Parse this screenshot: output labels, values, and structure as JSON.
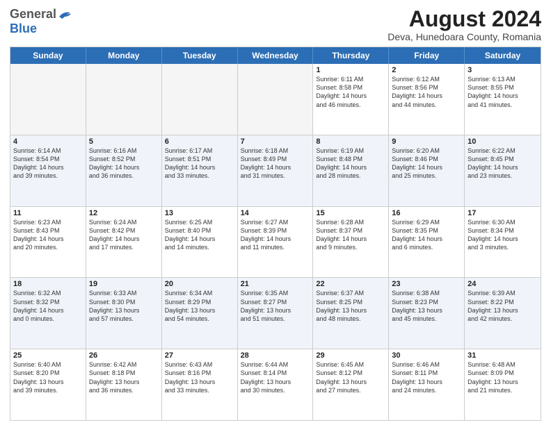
{
  "header": {
    "logo_general": "General",
    "logo_blue": "Blue",
    "month_title": "August 2024",
    "location": "Deva, Hunedoara County, Romania"
  },
  "days_of_week": [
    "Sunday",
    "Monday",
    "Tuesday",
    "Wednesday",
    "Thursday",
    "Friday",
    "Saturday"
  ],
  "weeks": [
    [
      {
        "day": "",
        "info": "",
        "empty": true
      },
      {
        "day": "",
        "info": "",
        "empty": true
      },
      {
        "day": "",
        "info": "",
        "empty": true
      },
      {
        "day": "",
        "info": "",
        "empty": true
      },
      {
        "day": "1",
        "info": "Sunrise: 6:11 AM\nSunset: 8:58 PM\nDaylight: 14 hours\nand 46 minutes.",
        "empty": false
      },
      {
        "day": "2",
        "info": "Sunrise: 6:12 AM\nSunset: 8:56 PM\nDaylight: 14 hours\nand 44 minutes.",
        "empty": false
      },
      {
        "day": "3",
        "info": "Sunrise: 6:13 AM\nSunset: 8:55 PM\nDaylight: 14 hours\nand 41 minutes.",
        "empty": false
      }
    ],
    [
      {
        "day": "4",
        "info": "Sunrise: 6:14 AM\nSunset: 8:54 PM\nDaylight: 14 hours\nand 39 minutes.",
        "empty": false
      },
      {
        "day": "5",
        "info": "Sunrise: 6:16 AM\nSunset: 8:52 PM\nDaylight: 14 hours\nand 36 minutes.",
        "empty": false
      },
      {
        "day": "6",
        "info": "Sunrise: 6:17 AM\nSunset: 8:51 PM\nDaylight: 14 hours\nand 33 minutes.",
        "empty": false
      },
      {
        "day": "7",
        "info": "Sunrise: 6:18 AM\nSunset: 8:49 PM\nDaylight: 14 hours\nand 31 minutes.",
        "empty": false
      },
      {
        "day": "8",
        "info": "Sunrise: 6:19 AM\nSunset: 8:48 PM\nDaylight: 14 hours\nand 28 minutes.",
        "empty": false
      },
      {
        "day": "9",
        "info": "Sunrise: 6:20 AM\nSunset: 8:46 PM\nDaylight: 14 hours\nand 25 minutes.",
        "empty": false
      },
      {
        "day": "10",
        "info": "Sunrise: 6:22 AM\nSunset: 8:45 PM\nDaylight: 14 hours\nand 23 minutes.",
        "empty": false
      }
    ],
    [
      {
        "day": "11",
        "info": "Sunrise: 6:23 AM\nSunset: 8:43 PM\nDaylight: 14 hours\nand 20 minutes.",
        "empty": false
      },
      {
        "day": "12",
        "info": "Sunrise: 6:24 AM\nSunset: 8:42 PM\nDaylight: 14 hours\nand 17 minutes.",
        "empty": false
      },
      {
        "day": "13",
        "info": "Sunrise: 6:25 AM\nSunset: 8:40 PM\nDaylight: 14 hours\nand 14 minutes.",
        "empty": false
      },
      {
        "day": "14",
        "info": "Sunrise: 6:27 AM\nSunset: 8:39 PM\nDaylight: 14 hours\nand 11 minutes.",
        "empty": false
      },
      {
        "day": "15",
        "info": "Sunrise: 6:28 AM\nSunset: 8:37 PM\nDaylight: 14 hours\nand 9 minutes.",
        "empty": false
      },
      {
        "day": "16",
        "info": "Sunrise: 6:29 AM\nSunset: 8:35 PM\nDaylight: 14 hours\nand 6 minutes.",
        "empty": false
      },
      {
        "day": "17",
        "info": "Sunrise: 6:30 AM\nSunset: 8:34 PM\nDaylight: 14 hours\nand 3 minutes.",
        "empty": false
      }
    ],
    [
      {
        "day": "18",
        "info": "Sunrise: 6:32 AM\nSunset: 8:32 PM\nDaylight: 14 hours\nand 0 minutes.",
        "empty": false
      },
      {
        "day": "19",
        "info": "Sunrise: 6:33 AM\nSunset: 8:30 PM\nDaylight: 13 hours\nand 57 minutes.",
        "empty": false
      },
      {
        "day": "20",
        "info": "Sunrise: 6:34 AM\nSunset: 8:29 PM\nDaylight: 13 hours\nand 54 minutes.",
        "empty": false
      },
      {
        "day": "21",
        "info": "Sunrise: 6:35 AM\nSunset: 8:27 PM\nDaylight: 13 hours\nand 51 minutes.",
        "empty": false
      },
      {
        "day": "22",
        "info": "Sunrise: 6:37 AM\nSunset: 8:25 PM\nDaylight: 13 hours\nand 48 minutes.",
        "empty": false
      },
      {
        "day": "23",
        "info": "Sunrise: 6:38 AM\nSunset: 8:23 PM\nDaylight: 13 hours\nand 45 minutes.",
        "empty": false
      },
      {
        "day": "24",
        "info": "Sunrise: 6:39 AM\nSunset: 8:22 PM\nDaylight: 13 hours\nand 42 minutes.",
        "empty": false
      }
    ],
    [
      {
        "day": "25",
        "info": "Sunrise: 6:40 AM\nSunset: 8:20 PM\nDaylight: 13 hours\nand 39 minutes.",
        "empty": false
      },
      {
        "day": "26",
        "info": "Sunrise: 6:42 AM\nSunset: 8:18 PM\nDaylight: 13 hours\nand 36 minutes.",
        "empty": false
      },
      {
        "day": "27",
        "info": "Sunrise: 6:43 AM\nSunset: 8:16 PM\nDaylight: 13 hours\nand 33 minutes.",
        "empty": false
      },
      {
        "day": "28",
        "info": "Sunrise: 6:44 AM\nSunset: 8:14 PM\nDaylight: 13 hours\nand 30 minutes.",
        "empty": false
      },
      {
        "day": "29",
        "info": "Sunrise: 6:45 AM\nSunset: 8:12 PM\nDaylight: 13 hours\nand 27 minutes.",
        "empty": false
      },
      {
        "day": "30",
        "info": "Sunrise: 6:46 AM\nSunset: 8:11 PM\nDaylight: 13 hours\nand 24 minutes.",
        "empty": false
      },
      {
        "day": "31",
        "info": "Sunrise: 6:48 AM\nSunset: 8:09 PM\nDaylight: 13 hours\nand 21 minutes.",
        "empty": false
      }
    ]
  ]
}
